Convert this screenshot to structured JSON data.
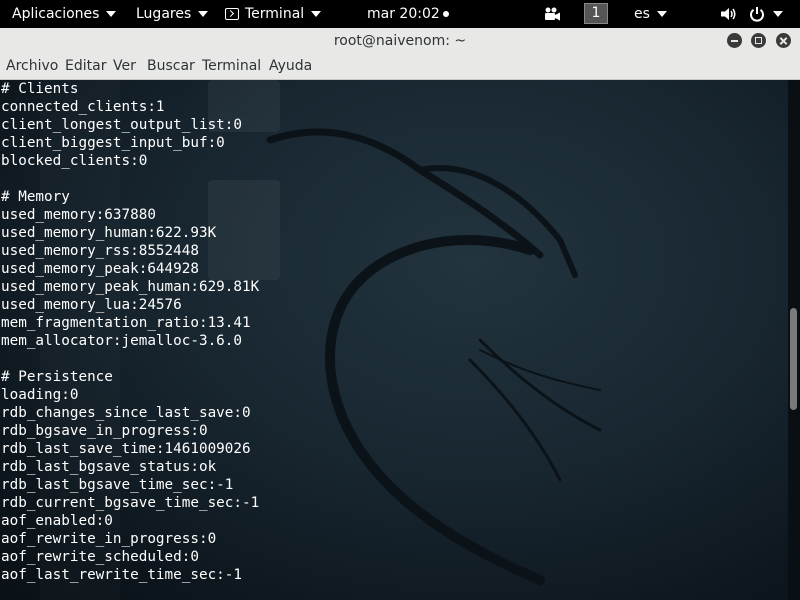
{
  "top_panel": {
    "applications": "Aplicaciones",
    "places": "Lugares",
    "terminal_app": "Terminal",
    "clock": "mar 20:02",
    "workspace": "1",
    "keyboard_layout": "es"
  },
  "window": {
    "title": "root@naivenom: ~"
  },
  "menu": [
    "Archivo",
    "Editar",
    "Ver",
    "Buscar",
    "Terminal",
    "Ayuda"
  ],
  "terminal": {
    "lines": [
      "# Clients",
      "connected_clients:1",
      "client_longest_output_list:0",
      "client_biggest_input_buf:0",
      "blocked_clients:0",
      "",
      "# Memory",
      "used_memory:637880",
      "used_memory_human:622.93K",
      "used_memory_rss:8552448",
      "used_memory_peak:644928",
      "used_memory_peak_human:629.81K",
      "used_memory_lua:24576",
      "mem_fragmentation_ratio:13.41",
      "mem_allocator:jemalloc-3.6.0",
      "",
      "# Persistence",
      "loading:0",
      "rdb_changes_since_last_save:0",
      "rdb_bgsave_in_progress:0",
      "rdb_last_save_time:1461009026",
      "rdb_last_bgsave_status:ok",
      "rdb_last_bgsave_time_sec:-1",
      "rdb_current_bgsave_time_sec:-1",
      "aof_enabled:0",
      "aof_rewrite_in_progress:0",
      "aof_rewrite_scheduled:0",
      "aof_last_rewrite_time_sec:-1"
    ]
  },
  "colors": {
    "panel_bg": "#000000",
    "chrome_bg": "#e8e8e7",
    "terminal_bg": "#182630",
    "terminal_fg": "#ffffff"
  }
}
